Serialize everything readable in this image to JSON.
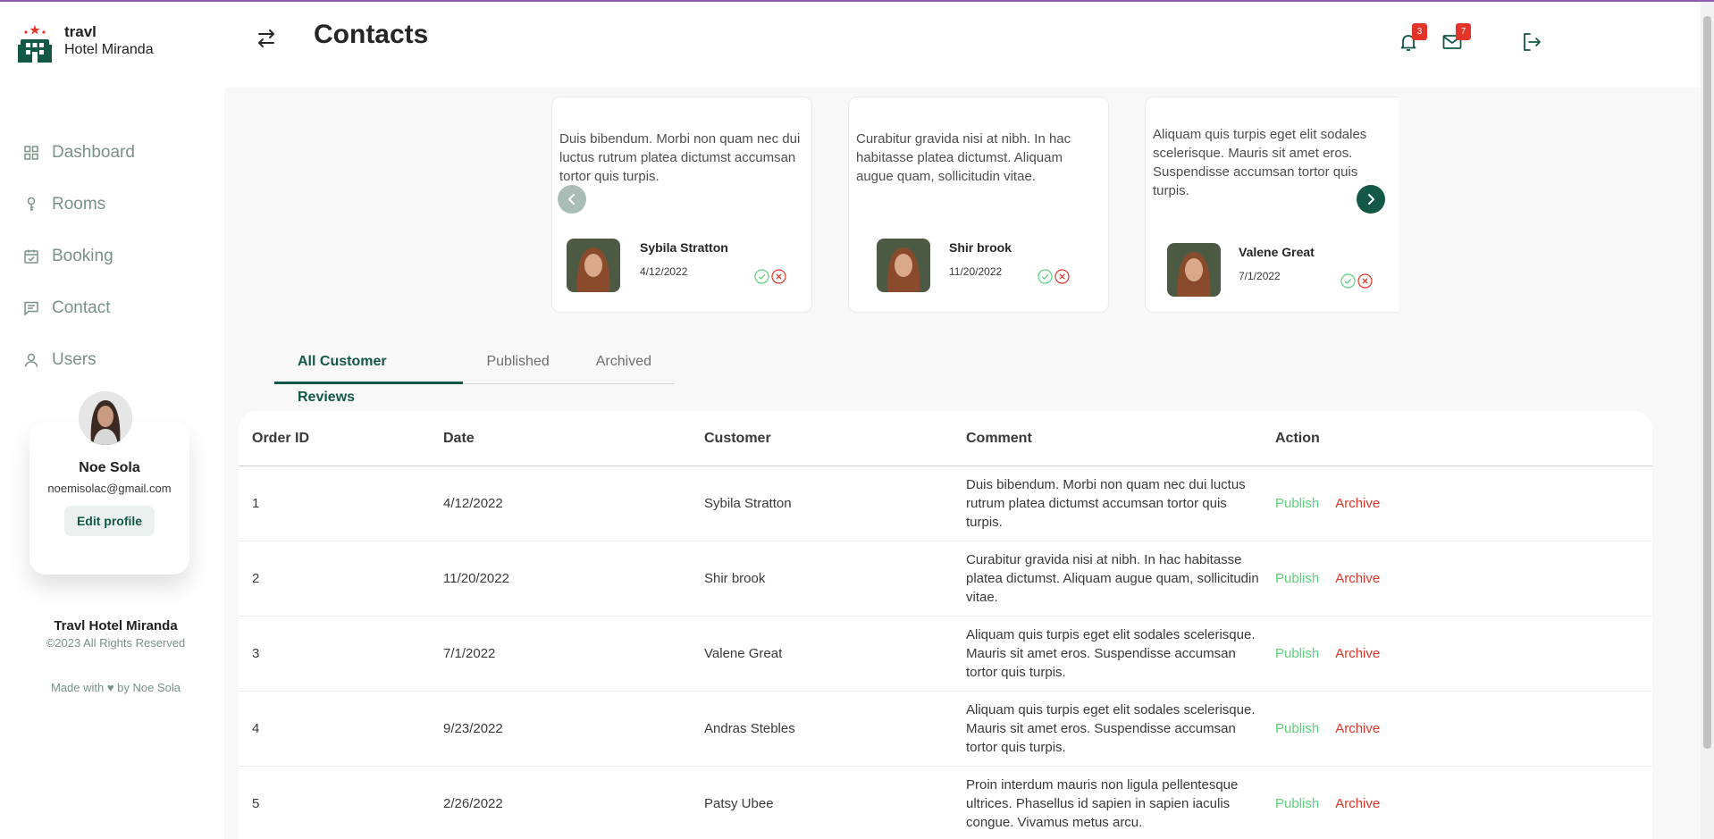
{
  "brand": {
    "name": "travl",
    "subtitle": "Hotel Miranda"
  },
  "nav": [
    {
      "label": "Dashboard",
      "icon": "dashboard-icon"
    },
    {
      "label": "Rooms",
      "icon": "key-icon"
    },
    {
      "label": "Booking",
      "icon": "calendar-icon"
    },
    {
      "label": "Contact",
      "icon": "message-icon"
    },
    {
      "label": "Users",
      "icon": "user-icon"
    }
  ],
  "profile": {
    "name": "Noe Sola",
    "email": "noemisolac@gmail.com",
    "edit_label": "Edit profile"
  },
  "footer": {
    "title": "Travl Hotel Miranda",
    "copyright": "©2023 All Rights Reserved",
    "made_with": "Made with ♥ by Noe Sola"
  },
  "header": {
    "title": "Contacts",
    "notifications_count": "3",
    "messages_count": "7"
  },
  "review_cards": [
    {
      "text": "Duis bibendum. Morbi non quam nec dui luctus rutrum platea dictumst accumsan tortor quis turpis.",
      "name": "Sybila Stratton",
      "date": "4/12/2022"
    },
    {
      "text": "Curabitur gravida nisi at nibh. In hac habitasse platea dictumst. Aliquam augue quam, sollicitudin vitae.",
      "name": "Shir brook",
      "date": "11/20/2022"
    },
    {
      "text": "Aliquam quis turpis eget elit sodales scelerisque. Mauris sit amet eros. Suspendisse accumsan tortor quis turpis.",
      "name": "Valene Great",
      "date": "7/1/2022"
    }
  ],
  "tabs": [
    "All Customer Reviews",
    "Published",
    "Archived"
  ],
  "table": {
    "headers": [
      "Order ID",
      "Date",
      "Customer",
      "Comment",
      "Action"
    ],
    "publish_label": "Publish",
    "archive_label": "Archive",
    "rows": [
      {
        "id": "1",
        "date": "4/12/2022",
        "customer": "Sybila Stratton",
        "comment": "Duis bibendum. Morbi non quam nec dui luctus rutrum platea dictumst accumsan tortor quis turpis."
      },
      {
        "id": "2",
        "date": "11/20/2022",
        "customer": "Shir brook",
        "comment": "Curabitur gravida nisi at nibh. In hac habitasse platea dictumst. Aliquam augue quam, sollicitudin vitae."
      },
      {
        "id": "3",
        "date": "7/1/2022",
        "customer": "Valene Great",
        "comment": "Aliquam quis turpis eget elit sodales scelerisque. Mauris sit amet eros. Suspendisse accumsan tortor quis turpis."
      },
      {
        "id": "4",
        "date": "9/23/2022",
        "customer": "Andras Stebles",
        "comment": "Aliquam quis turpis eget elit sodales scelerisque. Mauris sit amet eros. Suspendisse accumsan tortor quis turpis."
      },
      {
        "id": "5",
        "date": "2/26/2022",
        "customer": "Patsy Ubee",
        "comment": "Proin interdum mauris non ligula pellentesque ultrices. Phasellus id sapien in sapien iaculis congue. Vivamus metus arcu."
      }
    ]
  },
  "colors": {
    "primary": "#135846",
    "muted": "#799283",
    "danger": "#e23428",
    "success": "#5ad07a"
  }
}
